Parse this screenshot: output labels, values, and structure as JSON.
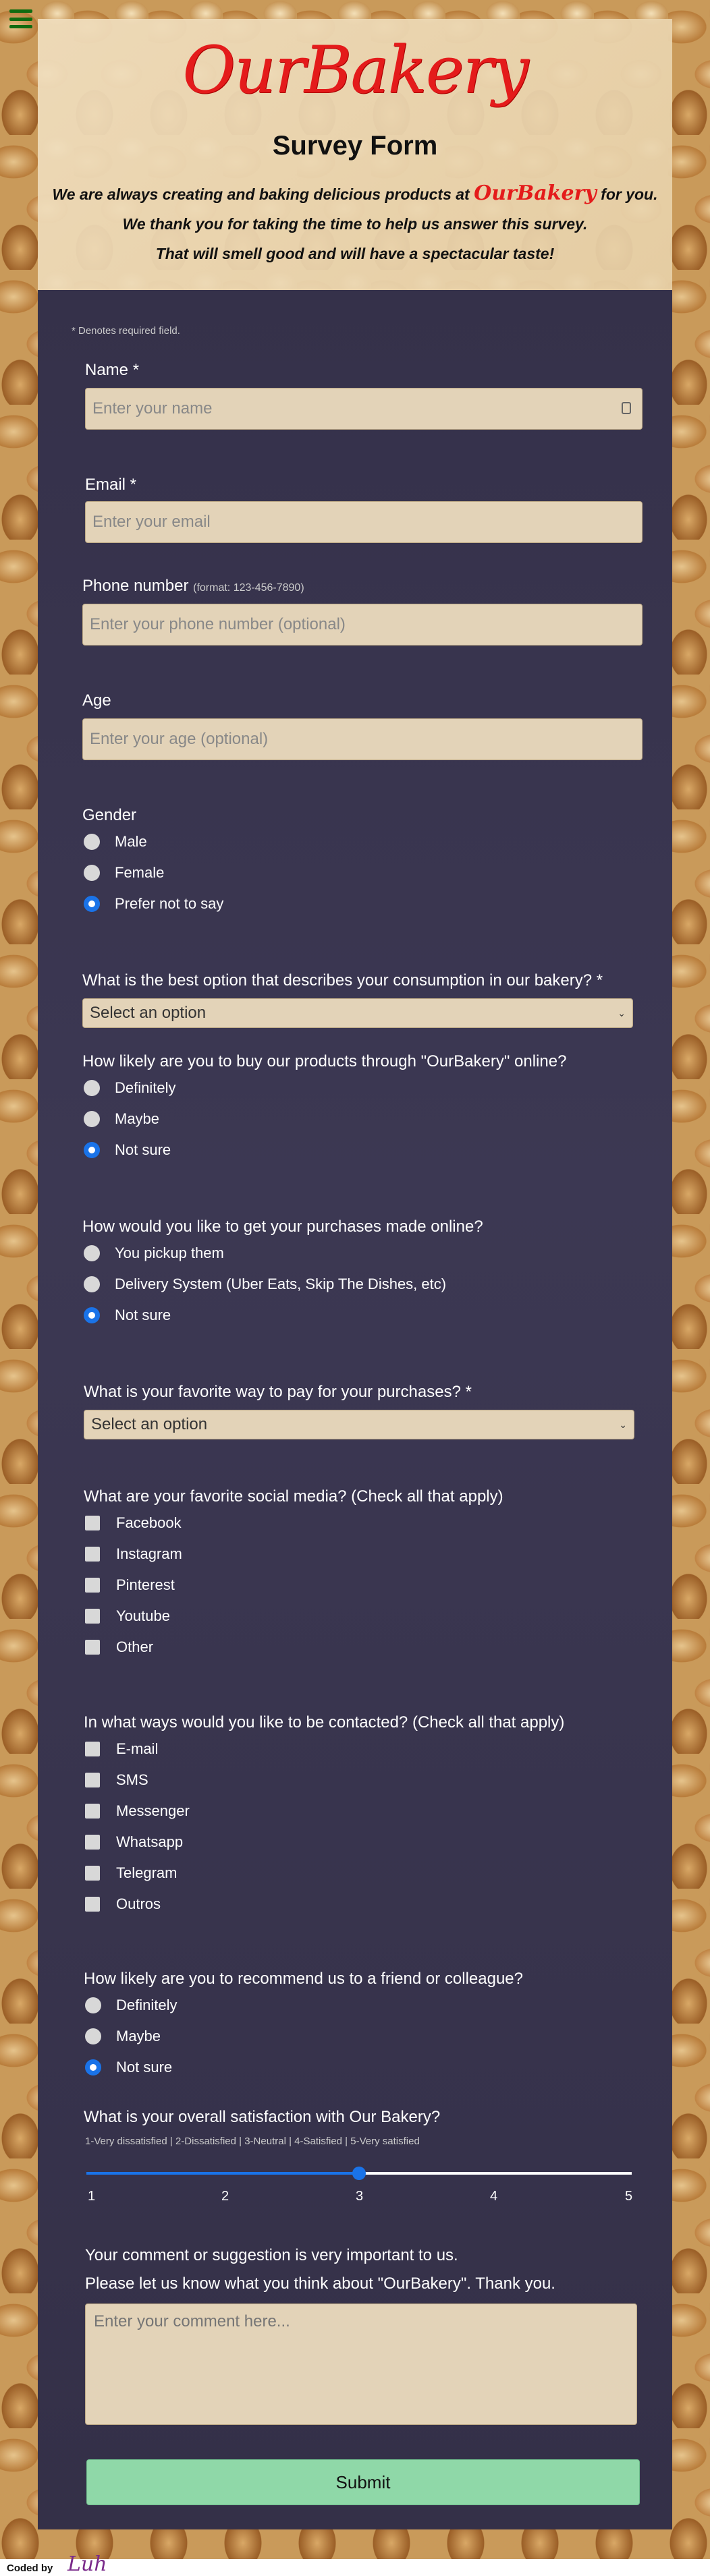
{
  "header": {
    "logo": "OurBakery",
    "title": "Survey Form",
    "intro_pre": "We are always creating and baking delicious products at",
    "intro_brand": "OurBakery",
    "intro_post": "for you.",
    "line2": "We thank you for taking the time to help us answer this survey.",
    "line3": "That will smell good and will have a spectacular taste!"
  },
  "form": {
    "required_note": "* Denotes required field.",
    "name": {
      "label": "Name *",
      "placeholder": "Enter your name"
    },
    "email": {
      "label": "Email *",
      "placeholder": "Enter your email"
    },
    "phone": {
      "label": "Phone number",
      "hint": "(format: 123-456-7890)",
      "placeholder": "Enter your phone number (optional)"
    },
    "age": {
      "label": "Age",
      "placeholder": "Enter your age (optional)"
    },
    "gender": {
      "label": "Gender",
      "options": [
        "Male",
        "Female",
        "Prefer not to say"
      ],
      "selected": 2
    },
    "consumption": {
      "label": "What is the best option that describes your consumption in our bakery? *",
      "value": "Select an option"
    },
    "buy_online": {
      "label": "How likely are you to buy our products through \"OurBakery\" online?",
      "options": [
        "Definitely",
        "Maybe",
        "Not sure"
      ],
      "selected": 2
    },
    "get_purchases": {
      "label": "How would you like to get your purchases made online?",
      "options": [
        "You pickup them",
        "Delivery System (Uber Eats, Skip The Dishes, etc)",
        "Not sure"
      ],
      "selected": 2
    },
    "pay": {
      "label": "What is your favorite way to pay for your purchases? *",
      "value": "Select an option"
    },
    "social": {
      "label": "What are your favorite social media? (Check all that apply)",
      "options": [
        "Facebook",
        "Instagram",
        "Pinterest",
        "Youtube",
        "Other"
      ]
    },
    "contact": {
      "label": "In what ways would you like to be contacted? (Check all that apply)",
      "options": [
        "E-mail",
        "SMS",
        "Messenger",
        "Whatsapp",
        "Telegram",
        "Outros"
      ]
    },
    "recommend": {
      "label": "How likely are you to recommend us to a friend or colleague?",
      "options": [
        "Definitely",
        "Maybe",
        "Not sure"
      ],
      "selected": 2
    },
    "satisfaction": {
      "label": "What is your overall satisfaction with Our Bakery?",
      "scale_note": "1-Very dissatisfied | 2-Dissatisfied | 3-Neutral | 4-Satisfied | 5-Very satisfied",
      "ticks": [
        "1",
        "2",
        "3",
        "4",
        "5"
      ],
      "value": 3,
      "min": 1,
      "max": 5
    },
    "comment": {
      "line1": "Your comment or suggestion is very important to us.",
      "line2": "Please let us know what you think about \"OurBakery\". Thank you.",
      "placeholder": "Enter your comment here..."
    },
    "submit": "Submit"
  },
  "footer": {
    "coded_by": "Coded by",
    "signature": "Luh"
  },
  "colors": {
    "accent": "#1a73e8",
    "brand": "#e41b1b",
    "submit": "#8fd8a8",
    "input_bg": "#e3d3b8",
    "menu": "#106b10"
  }
}
